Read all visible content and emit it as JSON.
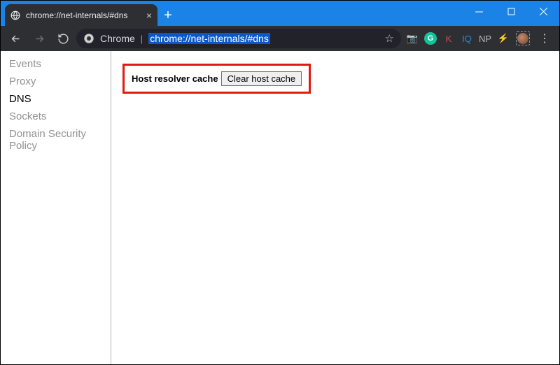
{
  "window": {
    "tab": {
      "title": "chrome://net-internals/#dns",
      "favicon_name": "globe-icon"
    }
  },
  "toolbar": {
    "back_disabled": false,
    "forward_disabled": true,
    "omnibox": {
      "origin_label": "Chrome",
      "url": "chrome://net-internals/#dns"
    },
    "extensions": [
      {
        "name": "camera-ext",
        "glyph": "📷",
        "bg": "transparent",
        "fg": "#cfcfcf"
      },
      {
        "name": "grammarly-ext",
        "glyph": "G",
        "bg": "#15c39a",
        "fg": "#ffffff"
      },
      {
        "name": "k-ext",
        "glyph": "K",
        "bg": "transparent",
        "fg": "#d24b4b"
      },
      {
        "name": "iq-ext",
        "glyph": "IQ",
        "bg": "transparent",
        "fg": "#2a89d6"
      },
      {
        "name": "np-ext",
        "glyph": "NP",
        "bg": "transparent",
        "fg": "#b9b9b9"
      },
      {
        "name": "bolt-ext",
        "glyph": "⚡",
        "bg": "transparent",
        "fg": "#3a7ee0"
      }
    ]
  },
  "sidebar": {
    "items": [
      {
        "label": "Events",
        "active": false
      },
      {
        "label": "Proxy",
        "active": false
      },
      {
        "label": "DNS",
        "active": true
      },
      {
        "label": "Sockets",
        "active": false
      },
      {
        "label": "Domain Security Policy",
        "active": false
      }
    ]
  },
  "main": {
    "section_label": "Host resolver cache",
    "clear_button_label": "Clear host cache"
  }
}
